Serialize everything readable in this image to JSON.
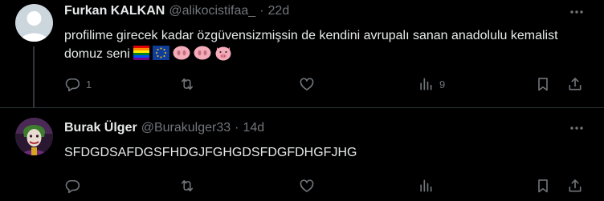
{
  "tweets": [
    {
      "display_name": "Furkan KALKAN",
      "handle": "@alikocistifaa_",
      "separator": "·",
      "time": "22d",
      "text": "profilime girecek kadar özgüvensizmişsin de kendini avrupalı sanan anadolulu kemalist domuz seni",
      "emojis": [
        "rainbow-flag",
        "eu-flag",
        "pig-nose",
        "pig-nose",
        "pig-face"
      ],
      "stats": {
        "replies": "1",
        "retweets": "",
        "likes": "",
        "views": "9"
      },
      "avatar": "default-avatar"
    },
    {
      "display_name": "Burak Ülger",
      "handle": "@Burakulger33",
      "separator": "·",
      "time": "14d",
      "text": "SFDGDSAFDGSFHDGJFGHGDSFDGFDHGFJHG",
      "emojis": [],
      "stats": {
        "replies": "",
        "retweets": "",
        "likes": "",
        "views": ""
      },
      "avatar": "joker-avatar"
    }
  ],
  "colors": {
    "background": "#000000",
    "primary_text": "#e7e9ea",
    "secondary_text": "#71767b",
    "divider": "#2f3336",
    "thread_line": "#333639"
  },
  "icons": [
    "more-icon",
    "reply-icon",
    "retweet-icon",
    "like-icon",
    "views-icon",
    "bookmark-icon",
    "share-icon"
  ]
}
